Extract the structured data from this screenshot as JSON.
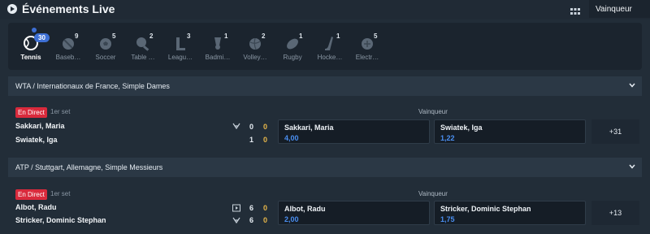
{
  "header": {
    "title": "Événements Live",
    "market_select": "Vainqueur"
  },
  "sports": [
    {
      "label": "Tennis",
      "count": "30",
      "icon": "tennis-icon",
      "active": true
    },
    {
      "label": "Baseb…",
      "count": "9",
      "icon": "baseball-icon"
    },
    {
      "label": "Soccer",
      "count": "5",
      "icon": "soccer-icon"
    },
    {
      "label": "Table …",
      "count": "2",
      "icon": "table-tennis-icon"
    },
    {
      "label": "Leagu…",
      "count": "3",
      "icon": "league-of-legends-icon"
    },
    {
      "label": "Badmi…",
      "count": "1",
      "icon": "badminton-icon"
    },
    {
      "label": "Volley…",
      "count": "2",
      "icon": "volleyball-icon"
    },
    {
      "label": "Rugby",
      "count": "1",
      "icon": "rugby-icon"
    },
    {
      "label": "Hocke…",
      "count": "1",
      "icon": "hockey-icon"
    },
    {
      "label": "Electr…",
      "count": "5",
      "icon": "esports-icon"
    }
  ],
  "events": [
    {
      "competition": "WTA / Internationaux de France, Simple Dames",
      "live": "En Direct",
      "period": "1er set",
      "market": "Vainqueur",
      "team1": {
        "name": "Sakkari, Maria",
        "sets": "0",
        "points": "0"
      },
      "team2": {
        "name": "Swiatek, Iga",
        "sets": "1",
        "points": "0"
      },
      "odds1": {
        "name": "Sakkari, Maria",
        "price": "4,00"
      },
      "odds2": {
        "name": "Swiatek, Iga",
        "price": "1,22"
      },
      "more": "+31"
    },
    {
      "competition": "ATP / Stuttgart, Allemagne, Simple Messieurs",
      "live": "En Direct",
      "period": "1er set",
      "market": "Vainqueur",
      "team1": {
        "name": "Albot, Radu",
        "sets": "6",
        "points": "0"
      },
      "team2": {
        "name": "Stricker, Dominic Stephan",
        "sets": "6",
        "points": "0"
      },
      "odds1": {
        "name": "Albot, Radu",
        "price": "2,00"
      },
      "odds2": {
        "name": "Stricker, Dominic Stephan",
        "price": "1,75"
      },
      "more": "+13"
    }
  ],
  "colors": {
    "accent": "#3d6fd4",
    "live": "#d92a3c",
    "price": "#4a8ef0",
    "points": "#e8b74a"
  }
}
